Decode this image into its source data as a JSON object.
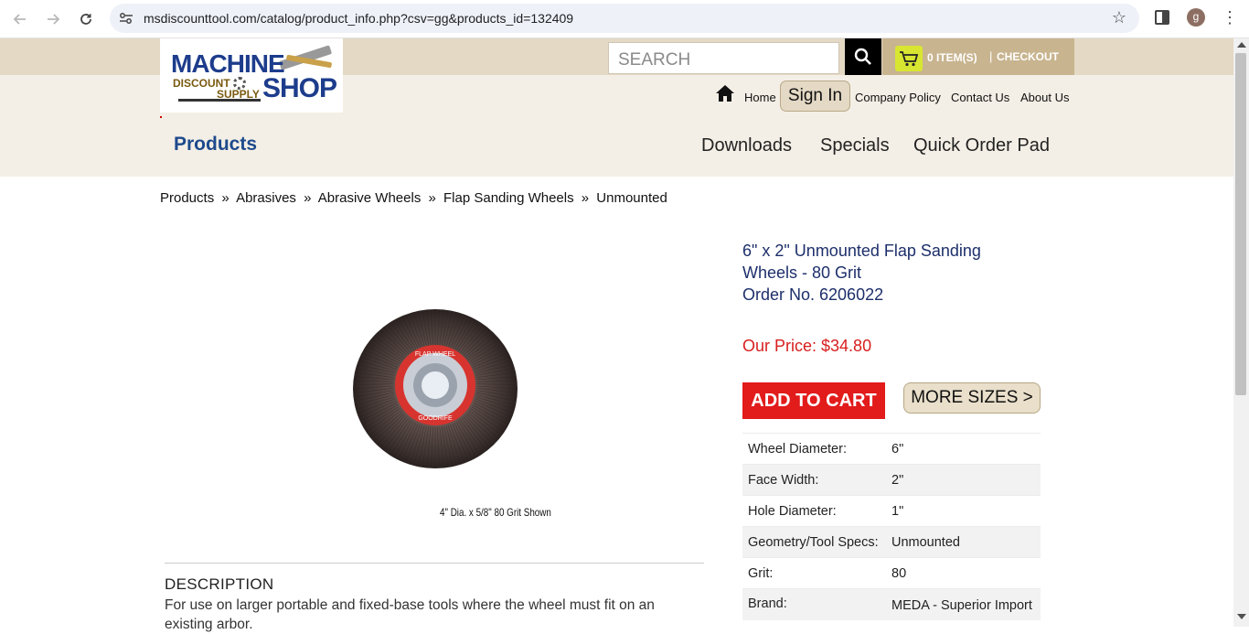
{
  "browser": {
    "url": "msdiscounttool.com/catalog/product_info.php?csv=gg&products_id=132409",
    "profile_initial": "g"
  },
  "header": {
    "logo": {
      "line1": "MACHINE",
      "line2": "SHOP",
      "discount": "DISCOUNT",
      "supply": "SUPPLY"
    },
    "search_placeholder": "SEARCH",
    "cart_items": "0 ITEM(S)",
    "cart_separator": "|",
    "checkout": "CHECKOUT",
    "nav": {
      "home": "Home",
      "sign_in": "Sign In",
      "company_policy": "Company Policy",
      "contact_us": "Contact Us",
      "about_us": "About Us"
    },
    "products_title": "Products",
    "links": {
      "downloads": "Downloads",
      "specials": "Specials",
      "quick_order": "Quick Order Pad"
    }
  },
  "breadcrumb": [
    "Products",
    "Abrasives",
    "Abrasive Wheels",
    "Flap Sanding Wheels",
    "Unmounted"
  ],
  "breadcrumb_sep": "»",
  "product": {
    "image_caption": "4\" Dia. x 5/8\" 80 Grit Shown",
    "wheel_label_top": "FLAP WHEEL",
    "wheel_label_bottom": "GOODRIFE",
    "title_line1": "6\" x 2\" Unmounted Flap Sanding",
    "title_line2": "Wheels - 80 Grit",
    "order_no": "Order No. 6206022",
    "price": "Our Price: $34.80",
    "add_to_cart": "ADD TO CART",
    "more_sizes": "MORE SIZES >",
    "specs": [
      {
        "key": "Wheel Diameter:",
        "value": "6\""
      },
      {
        "key": "Face Width:",
        "value": "2\""
      },
      {
        "key": "Hole Diameter:",
        "value": "1\""
      },
      {
        "key": "Geometry/Tool Specs:",
        "value": "Unmounted"
      },
      {
        "key": "Grit:",
        "value": "80"
      },
      {
        "key": "Brand:",
        "value": "MEDA - Superior Import"
      }
    ],
    "description_title": "DESCRIPTION",
    "description": "For use on larger portable and fixed-base tools where the wheel must fit on an existing arbor."
  },
  "colors": {
    "price_red": "#d81e1e",
    "add_to_cart_bg": "#e21b1b",
    "title_blue": "#1d2f6b",
    "header_beige": "#f4efe6",
    "topband": "#e4d9c5"
  }
}
